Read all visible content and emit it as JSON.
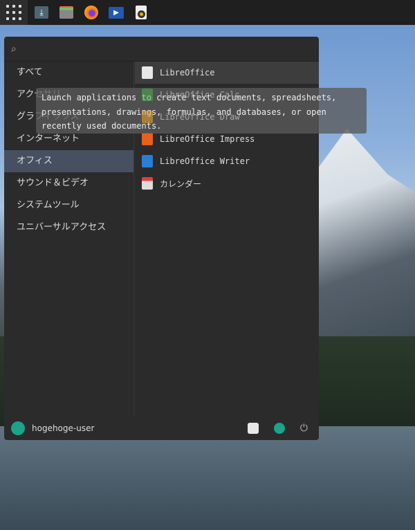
{
  "taskbar": {
    "icons": [
      "app-grid-icon",
      "download-icon",
      "file-manager-icon",
      "firefox-icon",
      "video-editor-icon",
      "speaker-icon"
    ]
  },
  "search": {
    "placeholder": "",
    "value": ""
  },
  "categories": [
    {
      "label": "すべて"
    },
    {
      "label": "アクセサリ"
    },
    {
      "label": "グラフィックス"
    },
    {
      "label": "インターネット"
    },
    {
      "label": "オフィス"
    },
    {
      "label": "サウンド＆ビデオ"
    },
    {
      "label": "システムツール"
    },
    {
      "label": "ユニバーサルアクセス"
    }
  ],
  "selected_category": "オフィス",
  "apps": [
    {
      "label": "LibreOffice",
      "color": "#e8e8e8"
    },
    {
      "label": "LibreOffice Calc",
      "color": "#4caf50"
    },
    {
      "label": "LibreOffice Draw",
      "color": "#f0a830"
    },
    {
      "label": "LibreOffice Impress",
      "color": "#e8601c"
    },
    {
      "label": "LibreOffice Writer",
      "color": "#2a7fd4"
    },
    {
      "label": "カレンダー",
      "color": "#e04040"
    }
  ],
  "tooltip": "Launch applications to create text documents, spreadsheets, presentations, drawings, formulas, and databases, or open recently used documents.",
  "footer": {
    "username": "hogehoge-user"
  }
}
